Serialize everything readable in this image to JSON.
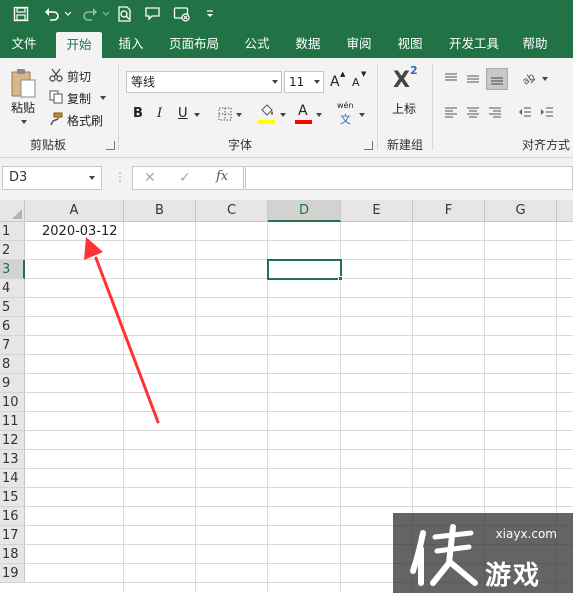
{
  "quick_access": {
    "icons": [
      "save-icon",
      "undo-icon",
      "redo-icon",
      "print-preview-icon",
      "touch-mode-icon",
      "automation-icon",
      "customize-qat-icon"
    ]
  },
  "tabs": [
    {
      "label": "文件"
    },
    {
      "label": "开始",
      "active": true
    },
    {
      "label": "插入"
    },
    {
      "label": "页面布局"
    },
    {
      "label": "公式"
    },
    {
      "label": "数据"
    },
    {
      "label": "审阅"
    },
    {
      "label": "视图"
    },
    {
      "label": "开发工具"
    },
    {
      "label": "帮助"
    }
  ],
  "ribbon": {
    "clipboard": {
      "paste": "粘贴",
      "cut": "剪切",
      "copy": "复制",
      "format_painter": "格式刷",
      "group_label": "剪贴板"
    },
    "font": {
      "font_name": "等线",
      "font_size": "11",
      "grow": "A",
      "shrink": "A",
      "bold": "B",
      "italic": "I",
      "underline": "U",
      "phonetic_top": "wén",
      "phonetic_bottom": "文",
      "font_color_letter": "A",
      "group_label": "字体",
      "fill_color": "#ffff00",
      "font_color": "#ff0000"
    },
    "newgroup": {
      "superscript_letter": "X",
      "superscript_num": "2",
      "superscript_label": "上标",
      "group_label": "新建组"
    },
    "alignment": {
      "group_label": "对齐方式"
    }
  },
  "formula_bar": {
    "name_box": "D3",
    "cancel": "✕",
    "enter": "✓",
    "fx": "fx",
    "formula": ""
  },
  "sheet": {
    "columns": [
      "A",
      "B",
      "C",
      "D",
      "E",
      "F",
      "G"
    ],
    "rows": [
      "1",
      "2",
      "3",
      "4",
      "5",
      "6",
      "7",
      "8",
      "9",
      "10",
      "11",
      "12",
      "13",
      "14",
      "15",
      "16",
      "17",
      "18",
      "19"
    ],
    "selected_column": "D",
    "selected_row": "3",
    "cells": {
      "A1": "2020-03-12"
    }
  },
  "annotation": {
    "arrow_color": "#ff3333"
  },
  "watermark": {
    "url": "xiayx.com",
    "name": "游戏"
  },
  "colors": {
    "excel_green": "#217346"
  }
}
